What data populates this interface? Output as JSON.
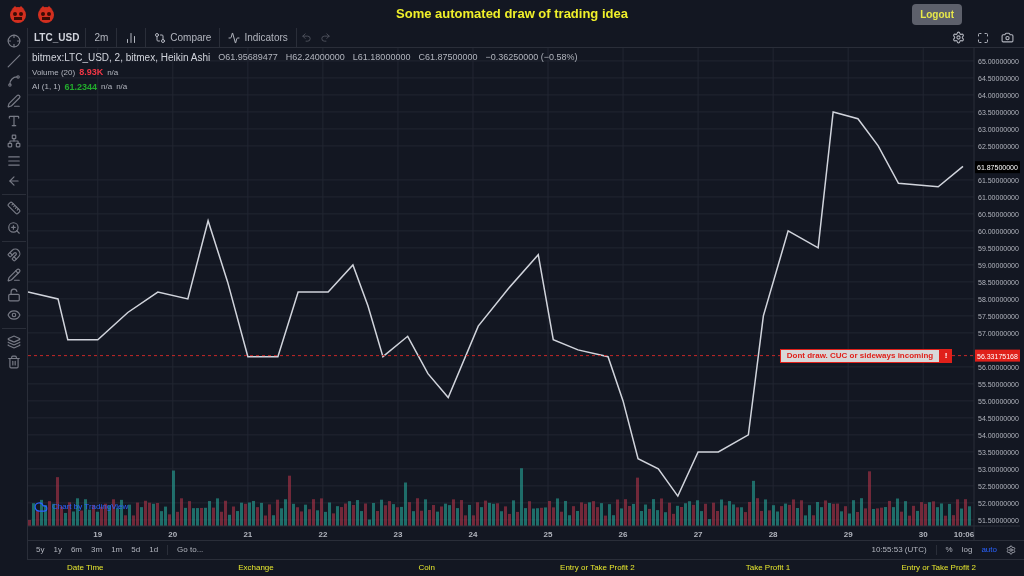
{
  "header": {
    "title": "Some automated draw of trading idea",
    "logout": "Logout"
  },
  "toolbar": {
    "symbol": "LTC_USD",
    "interval": "2m",
    "compare": "Compare",
    "indicators": "Indicators"
  },
  "legend": {
    "series": "bitmex:LTC_USD, 2, bitmex, Heikin Ashi",
    "open": "O61.95689477",
    "high": "H62.24000000",
    "low": "L61.18000000",
    "close": "C61.87500000",
    "change": "−0.36250000 (−0.58%)",
    "studies": [
      {
        "name": "Volume (20)",
        "value": "8.93K",
        "color": "#f23645",
        "extra": [
          "n/a"
        ]
      },
      {
        "name": "AI (1, 1)",
        "value": "61.2344",
        "color": "#22ab2c",
        "extra": [
          "n/a",
          "n/a"
        ]
      }
    ]
  },
  "chart_data": {
    "type": "line",
    "x": [
      18.07,
      18.47,
      18.6,
      19,
      19.4,
      19.8,
      20.2,
      20.47,
      20.73,
      21,
      21.4,
      21.67,
      22.07,
      22.4,
      22.6,
      22.8,
      23.13,
      23.4,
      23.67,
      24.07,
      24.47,
      24.87,
      25.07,
      25.4,
      25.8,
      26,
      26.2,
      26.47,
      26.73,
      27,
      27.27,
      27.67,
      27.87,
      28.2,
      28.6,
      28.8,
      29.13,
      29.4,
      29.67,
      30.2,
      30.53
    ],
    "series": [
      {
        "color": "#d1d4dc",
        "values": [
          58.2,
          58.0,
          56.8,
          56.8,
          57.6,
          58.2,
          58.0,
          60.3,
          58.5,
          56.3,
          56.3,
          58.2,
          58.2,
          59.0,
          57.8,
          56.3,
          56.9,
          55.8,
          55.1,
          57.2,
          58.3,
          59.3,
          56.8,
          56.5,
          56.3,
          55.0,
          53.3,
          53.0,
          52.2,
          53.5,
          53.5,
          54.0,
          57.5,
          60.0,
          59.5,
          63.5,
          63.3,
          62.5,
          61.4,
          61.3,
          61.9
        ]
      }
    ],
    "xlim": [
      18.07,
      31.29
    ],
    "ylim": [
      51.32,
      65.38
    ],
    "grid": true,
    "ref_lines": [
      {
        "axis": "y",
        "value": 56.33175168,
        "color": "#c62828"
      }
    ],
    "xticks": [
      {
        "value": 19,
        "label": "19"
      },
      {
        "value": 20,
        "label": "20"
      },
      {
        "value": 21,
        "label": "21"
      },
      {
        "value": 22,
        "label": "22"
      },
      {
        "value": 23,
        "label": "23"
      },
      {
        "value": 24,
        "label": "24"
      },
      {
        "value": 25,
        "label": "25"
      },
      {
        "value": 26,
        "label": "26"
      },
      {
        "value": 27,
        "label": "27"
      },
      {
        "value": 28,
        "label": "28"
      },
      {
        "value": 29,
        "label": "29"
      },
      {
        "value": 30,
        "label": "30"
      }
    ],
    "yticks": [
      {
        "value": 51.5,
        "label": "51.50000000"
      },
      {
        "value": 52,
        "label": "52.00000000"
      },
      {
        "value": 52.5,
        "label": "52.50000000"
      },
      {
        "value": 53,
        "label": "53.00000000"
      },
      {
        "value": 53.5,
        "label": "53.50000000"
      },
      {
        "value": 54,
        "label": "54.00000000"
      },
      {
        "value": 54.5,
        "label": "54.50000000"
      },
      {
        "value": 55,
        "label": "55.00000000"
      },
      {
        "value": 55.5,
        "label": "55.50000000"
      },
      {
        "value": 56,
        "label": "56.00000000"
      },
      {
        "value": 57,
        "label": "57.00000000"
      },
      {
        "value": 57.5,
        "label": "57.50000000"
      },
      {
        "value": 58,
        "label": "58.00000000"
      },
      {
        "value": 58.5,
        "label": "58.50000000"
      },
      {
        "value": 59,
        "label": "59.00000000"
      },
      {
        "value": 59.5,
        "label": "59.50000000"
      },
      {
        "value": 60,
        "label": "60.00000000"
      },
      {
        "value": 60.5,
        "label": "60.50000000"
      },
      {
        "value": 61,
        "label": "61.00000000"
      },
      {
        "value": 61.5,
        "label": "61.50000000"
      },
      {
        "value": 62.5,
        "label": "62.50000000"
      },
      {
        "value": 63,
        "label": "63.00000000"
      },
      {
        "value": 63.5,
        "label": "63.50000000"
      },
      {
        "value": 64,
        "label": "64.00000000"
      },
      {
        "value": 64.5,
        "label": "64.50000000"
      },
      {
        "value": 65,
        "label": "65.00000000"
      }
    ]
  },
  "time_label": "10:06",
  "last_price": {
    "label": "61.87500000"
  },
  "alert": {
    "label": "56.33175168",
    "text": "Dont draw. CUC or sideways incoming",
    "button": "!"
  },
  "attribution": "Chart by TradingView",
  "ranges": [
    "5y",
    "1y",
    "6m",
    "3m",
    "1m",
    "5d",
    "1d"
  ],
  "goto": "Go to...",
  "clock": "10:55:53 (UTC)",
  "scale_options": [
    {
      "label": "%",
      "selected": false
    },
    {
      "label": "log",
      "selected": false
    },
    {
      "label": "auto",
      "selected": true
    }
  ],
  "columns": [
    "Date Time",
    "Exchange",
    "Coin",
    "Entry or Take Profit 2",
    "Take Profit 1",
    "Entry or Take Profit 2"
  ]
}
